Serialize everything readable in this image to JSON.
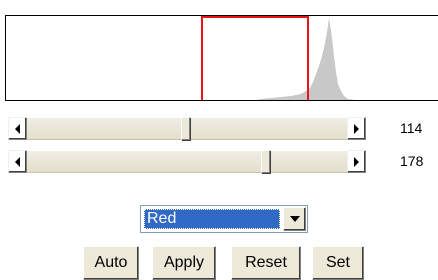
{
  "histogram": {
    "fill_color": "#c8c8c8",
    "selection_color": "#e8141a",
    "selection_range": [
      114,
      178
    ],
    "value_range": [
      0,
      255
    ]
  },
  "sliders": [
    {
      "value": "114",
      "position_fraction": 0.54
    },
    {
      "value": "178",
      "position_fraction": 0.78
    }
  ],
  "channel": {
    "selected": "Red"
  },
  "buttons": {
    "auto": "Auto",
    "apply": "Apply",
    "reset": "Reset",
    "set": "Set"
  }
}
